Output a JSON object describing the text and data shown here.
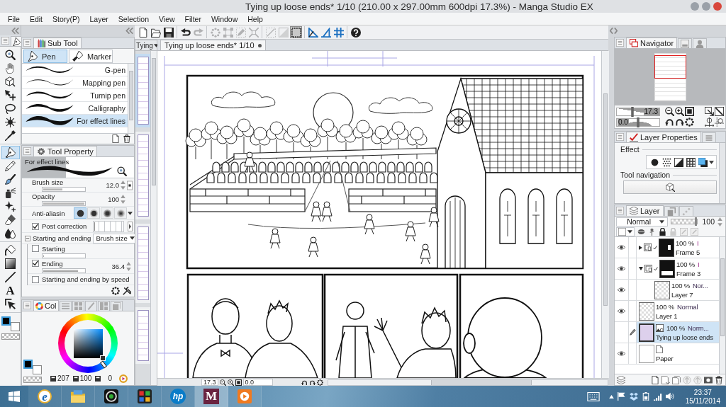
{
  "window": {
    "title": "Tying up loose ends* 1/10 (210.00 x 297.00mm 600dpi 17.3%) - Manga Studio EX"
  },
  "menu": [
    "File",
    "Edit",
    "Story(P)",
    "Layer",
    "Selection",
    "View",
    "Filter",
    "Window",
    "Help"
  ],
  "toolbar": [
    [
      {
        "kind": "new",
        "disabled": false,
        "on": false
      },
      {
        "kind": "open",
        "disabled": false,
        "on": false
      },
      {
        "kind": "save",
        "disabled": false,
        "on": false
      }
    ],
    [
      {
        "kind": "undo",
        "disabled": false,
        "on": false
      },
      {
        "kind": "redo",
        "disabled": true,
        "on": false
      }
    ],
    [
      {
        "kind": "dots",
        "disabled": true,
        "on": false
      },
      {
        "kind": "crop",
        "disabled": true,
        "on": false
      },
      {
        "kind": "penbox",
        "disabled": true,
        "on": false
      },
      {
        "kind": "expand",
        "disabled": true,
        "on": false
      }
    ],
    [
      {
        "kind": "clear",
        "disabled": true,
        "on": false
      },
      {
        "kind": "fillout",
        "disabled": true,
        "on": false
      },
      {
        "kind": "border",
        "disabled": false,
        "on": true
      }
    ],
    [
      {
        "kind": "ruler",
        "disabled": false,
        "on": false
      },
      {
        "kind": "perspective",
        "disabled": false,
        "on": false
      },
      {
        "kind": "grid",
        "disabled": false,
        "on": false
      }
    ],
    [
      {
        "kind": "help",
        "disabled": false,
        "on": false
      }
    ]
  ],
  "tools": [
    [
      {
        "kind": "zoom",
        "selected": false
      },
      {
        "kind": "hand",
        "selected": false
      },
      {
        "kind": "cube",
        "selected": false
      },
      {
        "kind": "move",
        "selected": false
      },
      {
        "kind": "lasso",
        "selected": false
      },
      {
        "kind": "wand",
        "selected": false
      },
      {
        "kind": "eyedropper",
        "selected": false
      }
    ],
    [
      {
        "kind": "pen",
        "selected": true
      },
      {
        "kind": "pencil",
        "selected": false
      },
      {
        "kind": "brush",
        "selected": false
      },
      {
        "kind": "airbrush",
        "selected": false
      },
      {
        "kind": "sparkle",
        "selected": false
      },
      {
        "kind": "eraser",
        "selected": false
      },
      {
        "kind": "drops",
        "selected": false
      }
    ],
    [
      {
        "kind": "bucket",
        "selected": false
      },
      {
        "kind": "gradient",
        "selected": false
      },
      {
        "kind": "line",
        "selected": false
      },
      {
        "kind": "text",
        "glyph": "A",
        "selected": false
      },
      {
        "kind": "arrow",
        "selected": false
      }
    ]
  ],
  "swatches": [
    {
      "color": "#000000",
      "selected": true
    },
    {
      "color": "#ffffff",
      "selected": false
    }
  ],
  "sub_tool": {
    "title": "Sub Tool",
    "groups": [
      {
        "label": "Pen",
        "selected": true
      },
      {
        "label": "Marker",
        "selected": false
      }
    ],
    "brushes": [
      {
        "label": "G-pen",
        "selected": false
      },
      {
        "label": "Mapping pen",
        "selected": false
      },
      {
        "label": "Turnip pen",
        "selected": false
      },
      {
        "label": "Calligraphy",
        "selected": false
      },
      {
        "label": "For effect lines",
        "selected": true
      }
    ]
  },
  "tool_property": {
    "title": "Tool Property",
    "preview_label": "For effect lines",
    "rows": [
      {
        "kind": "slider",
        "label": "Brush size",
        "value": "12.0",
        "level": 0.47
      },
      {
        "kind": "slider",
        "label": "Opacity",
        "value": "100",
        "level": 1
      },
      {
        "kind": "antialias",
        "label": "Anti-aliasin",
        "options": [
          {
            "selected": true
          },
          {
            "selected": false
          },
          {
            "selected": false
          },
          {
            "selected": false
          }
        ]
      },
      {
        "kind": "check",
        "label": "Post correction",
        "checked": true,
        "level": 0
      },
      {
        "kind": "section",
        "label": "Starting and ending",
        "expanded": true,
        "dropdown": "Brush size",
        "children": [
          {
            "kind": "check_slider",
            "label": "Starting",
            "checked": false,
            "level": 0
          },
          {
            "kind": "check_slider",
            "label": "Ending",
            "checked": true,
            "level": 0.85,
            "value": "36.4"
          },
          {
            "kind": "check",
            "label": "Starting and ending by speed",
            "checked": false
          }
        ]
      }
    ]
  },
  "color_panel": {
    "tabs": [
      {
        "kind": "wheel",
        "label": "Col",
        "selected": true
      },
      {
        "kind": "sliders",
        "selected": false
      },
      {
        "kind": "set",
        "selected": false
      },
      {
        "kind": "brush2",
        "selected": false
      },
      {
        "kind": "mix",
        "selected": false
      },
      {
        "kind": "history",
        "selected": false
      }
    ],
    "swatches": [
      {
        "color": "#000000",
        "selected": true
      },
      {
        "color": "#ffffff",
        "selected": false
      }
    ],
    "hue": "207",
    "saturation": "100",
    "value": "0"
  },
  "page_strip": {
    "tab": "Tying",
    "pages": [
      {
        "selected": true
      },
      {
        "selected": false
      },
      {
        "selected": false
      },
      {
        "selected": false
      }
    ]
  },
  "canvas": {
    "tab": "Tying up loose ends* 1/10",
    "modified": true,
    "zoom": "17.3",
    "angle": "0.0"
  },
  "navigator": {
    "tabs": [
      {
        "kind": "frames",
        "label": "Navigator",
        "selected": true
      },
      {
        "kind": "window",
        "selected": false
      },
      {
        "kind": "person",
        "selected": false
      }
    ],
    "zoom": {
      "value": "17.3",
      "level": 0.37
    },
    "angle": {
      "value": "0.0",
      "level": 0.5
    }
  },
  "layer_properties": {
    "tabs": [
      {
        "kind": "redcheck",
        "label": "Layer Properties",
        "selected": true
      },
      {
        "kind": "stack",
        "selected": false
      }
    ],
    "effect_label": "Effect",
    "tool_navigation_label": "Tool navigation"
  },
  "layer_panel": {
    "tabs": [
      {
        "kind": "layers",
        "label": "Layer",
        "selected": true
      },
      {
        "kind": "boxhand",
        "selected": false
      },
      {
        "kind": "dotsgraph",
        "selected": false
      }
    ],
    "blend_mode": "Normal",
    "opacity": {
      "value": "100",
      "level": 1
    },
    "layers": [
      {
        "kind": "frame",
        "name": "Frame 5",
        "opacity": "100 %",
        "mode": "I",
        "visible": true,
        "selected": false,
        "expanded": false
      },
      {
        "kind": "frame",
        "name": "Frame 3",
        "opacity": "100 %",
        "mode": "I",
        "visible": true,
        "selected": false,
        "expanded": true,
        "children": [
          {
            "kind": "raster",
            "name": "Layer 7",
            "opacity": "100 %",
            "mode": "Nor...",
            "visible": true,
            "selected": false
          }
        ]
      },
      {
        "kind": "raster",
        "name": "Layer 1",
        "opacity": "100 %",
        "mode": "Normal",
        "visible": true,
        "selected": false
      },
      {
        "kind": "image",
        "name": "Tying up loose ends",
        "opacity": "100 %",
        "mode": "Norm...",
        "visible": false,
        "selected": true
      },
      {
        "kind": "paper",
        "name": "Paper",
        "visible": true,
        "selected": false
      }
    ]
  },
  "taskbar": {
    "apps": [
      {
        "kind": "ie",
        "glyph": "e",
        "selected": false
      },
      {
        "kind": "folder",
        "selected": false
      },
      {
        "kind": "lens",
        "selected": false
      },
      {
        "kind": "puzzle",
        "selected": false
      },
      {
        "kind": "hp",
        "glyph": "hp",
        "selected": false
      },
      {
        "kind": "manga",
        "glyph": "M",
        "selected": true
      },
      {
        "kind": "media",
        "selected": false
      }
    ],
    "time": "23:37",
    "date": "15/11/2014"
  }
}
